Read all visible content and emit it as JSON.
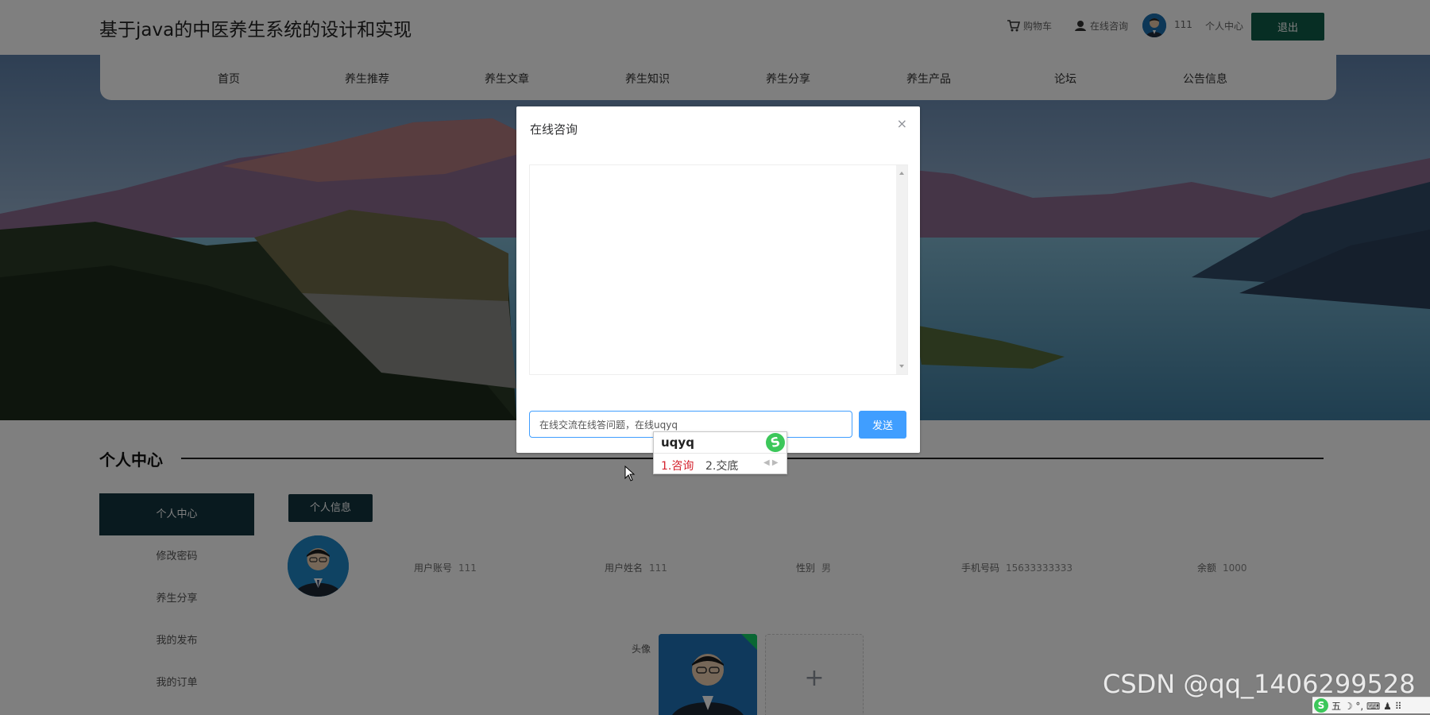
{
  "header": {
    "site_title": "基于java的中医养生系统的设计和实现",
    "cart": "购物车",
    "consult": "在线咨询",
    "username": "111",
    "personal_center": "个人中心",
    "logout": "退出"
  },
  "nav": [
    {
      "label": "首页"
    },
    {
      "label": "养生推荐"
    },
    {
      "label": "养生文章"
    },
    {
      "label": "养生知识"
    },
    {
      "label": "养生分享"
    },
    {
      "label": "养生产品"
    },
    {
      "label": "论坛"
    },
    {
      "label": "公告信息"
    }
  ],
  "personal": {
    "section_title": "个人中心",
    "menu": [
      {
        "label": "个人中心",
        "active": true
      },
      {
        "label": "修改密码"
      },
      {
        "label": "养生分享"
      },
      {
        "label": "我的发布"
      },
      {
        "label": "我的订单"
      }
    ],
    "tab": "个人信息",
    "fields": [
      {
        "label": "用户账号",
        "value": "111"
      },
      {
        "label": "用户姓名",
        "value": "111"
      },
      {
        "label": "性别",
        "value": "男"
      },
      {
        "label": "手机号码",
        "value": "15633333333"
      },
      {
        "label": "余额",
        "value": "1000"
      }
    ],
    "avatar_label": "头像",
    "upload_plus": "+"
  },
  "dialog": {
    "title": "在线咨询",
    "close": "×",
    "input_value": "在线交流在线答问题，在线uqyq",
    "send": "发送"
  },
  "ime": {
    "composition": "uqyq",
    "logo": "S",
    "candidates": [
      "1.咨询",
      "2.交底"
    ],
    "arrows": "◀ ▶"
  },
  "watermark": "CSDN @qq_1406299528",
  "tray": {
    "logo": "S",
    "text": "五 ☽ °, ⌨ ♟ ⠿"
  },
  "colors": {
    "accent": "#0f5c48",
    "dark_menu": "#13343f",
    "primary_blue": "#409eff",
    "ime_red": "#d4232e"
  }
}
